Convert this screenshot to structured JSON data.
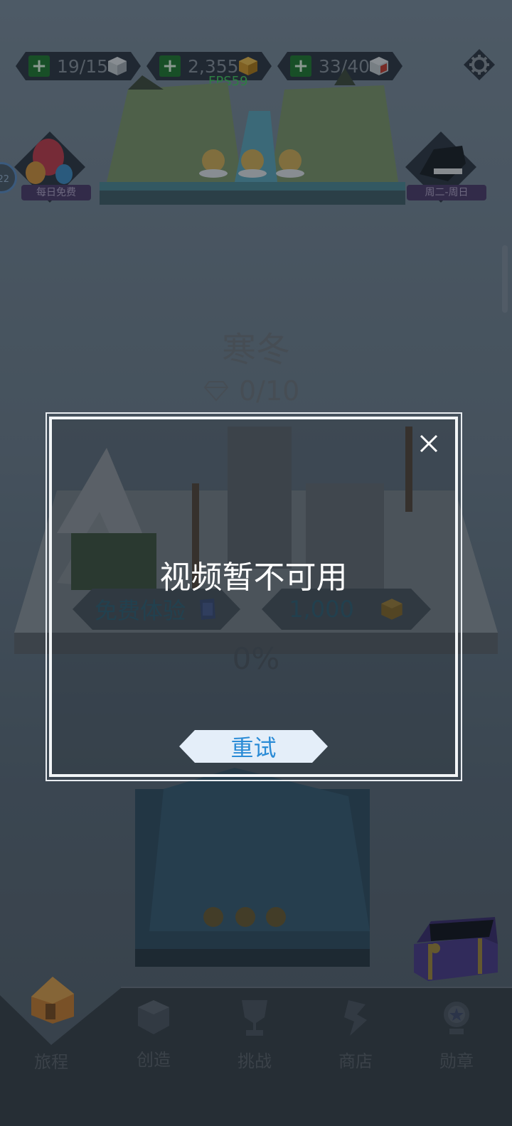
{
  "resources": [
    {
      "value": "19/15",
      "icon": "white-cube-icon"
    },
    {
      "value": "2,355",
      "icon": "gold-cube-icon"
    },
    {
      "value": "33/40",
      "icon": "red-cube-icon"
    }
  ],
  "fps": "FPS59",
  "side_badges": {
    "left_label": "每日免费",
    "left_circle": "22",
    "right_label": "周二-周日"
  },
  "chapter": {
    "title": "寒冬",
    "gems": "0/10",
    "free_trial_label": "免费体验",
    "price": "1,000",
    "progress": "0%"
  },
  "dialog": {
    "message": "视频暂不可用",
    "retry_label": "重试"
  },
  "nav": [
    {
      "label": "旅程",
      "icon": "house-icon"
    },
    {
      "label": "创造",
      "icon": "cube-icon"
    },
    {
      "label": "挑战",
      "icon": "trophy-icon"
    },
    {
      "label": "商店",
      "icon": "store-icon"
    },
    {
      "label": "勋章",
      "icon": "medal-icon"
    }
  ]
}
